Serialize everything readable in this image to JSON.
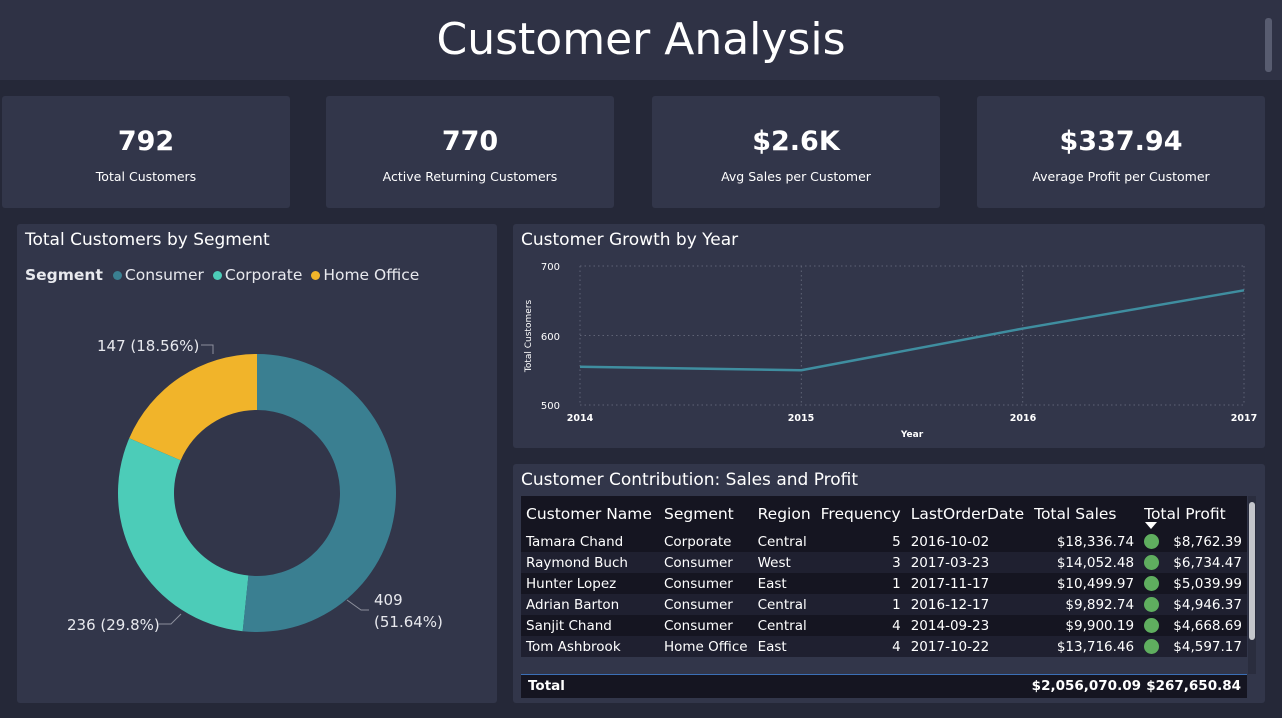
{
  "page": {
    "title": "Customer Analysis"
  },
  "kpis": [
    {
      "value": "792",
      "label": "Total Customers"
    },
    {
      "value": "770",
      "label": "Active Returning Customers"
    },
    {
      "value": "$2.6K",
      "label": "Avg Sales per Customer"
    },
    {
      "value": "$337.94",
      "label": "Average Profit per Customer"
    }
  ],
  "donut": {
    "title": "Total Customers by Segment",
    "legend_title": "Segment",
    "labels": {
      "home_office": "147 (18.56%)",
      "consumer_line1": "409",
      "consumer_line2": "(51.64%)",
      "corporate": "236 (29.8%)"
    }
  },
  "line_chart": {
    "title": "Customer Growth by Year",
    "y_label": "Total Customers",
    "x_label": "Year",
    "y_ticks": [
      "700",
      "600",
      "500"
    ],
    "x_ticks": [
      "2014",
      "2015",
      "2016",
      "2017"
    ]
  },
  "table": {
    "title": "Customer Contribution: Sales and Profit",
    "columns": [
      "Customer Name",
      "Segment",
      "Region",
      "Frequency",
      "LastOrderDate",
      "Total Sales",
      "Total Profit"
    ],
    "rows": [
      [
        "Tamara Chand",
        "Corporate",
        "Central",
        "5",
        "2016-10-02",
        "$18,336.74",
        "$8,762.39"
      ],
      [
        "Raymond Buch",
        "Consumer",
        "West",
        "3",
        "2017-03-23",
        "$14,052.48",
        "$6,734.47"
      ],
      [
        "Hunter Lopez",
        "Consumer",
        "East",
        "1",
        "2017-11-17",
        "$10,499.97",
        "$5,039.99"
      ],
      [
        "Adrian Barton",
        "Consumer",
        "Central",
        "1",
        "2016-12-17",
        "$9,892.74",
        "$4,946.37"
      ],
      [
        "Sanjit Chand",
        "Consumer",
        "Central",
        "4",
        "2014-09-23",
        "$9,900.19",
        "$4,668.69"
      ],
      [
        "Tom Ashbrook",
        "Home Office",
        "East",
        "4",
        "2017-10-22",
        "$13,716.46",
        "$4,597.17"
      ]
    ],
    "total_label": "Total",
    "total_sales": "$2,056,070.09",
    "total_profit": "$267,650.84",
    "profit_indicator": "green-circle-icon"
  },
  "colors": {
    "consumer": "#3a7f91",
    "corporate": "#4cccb8",
    "home_office": "#f1b42a",
    "line": "#3f8ea0"
  },
  "chart_data": [
    {
      "type": "pie",
      "title": "Total Customers by Segment",
      "legend_title": "Segment",
      "legend_position": "top",
      "categories": [
        "Consumer",
        "Corporate",
        "Home Office"
      ],
      "values": [
        409,
        236,
        147
      ],
      "percentages": [
        51.64,
        29.8,
        18.56
      ]
    },
    {
      "type": "line",
      "title": "Customer Growth by Year",
      "xlabel": "Year",
      "ylabel": "Total Customers",
      "x": [
        2014,
        2015,
        2016,
        2017
      ],
      "series": [
        {
          "values": [
            555,
            550,
            610,
            665
          ]
        }
      ],
      "ylim": [
        500,
        700
      ],
      "grid": true
    }
  ]
}
